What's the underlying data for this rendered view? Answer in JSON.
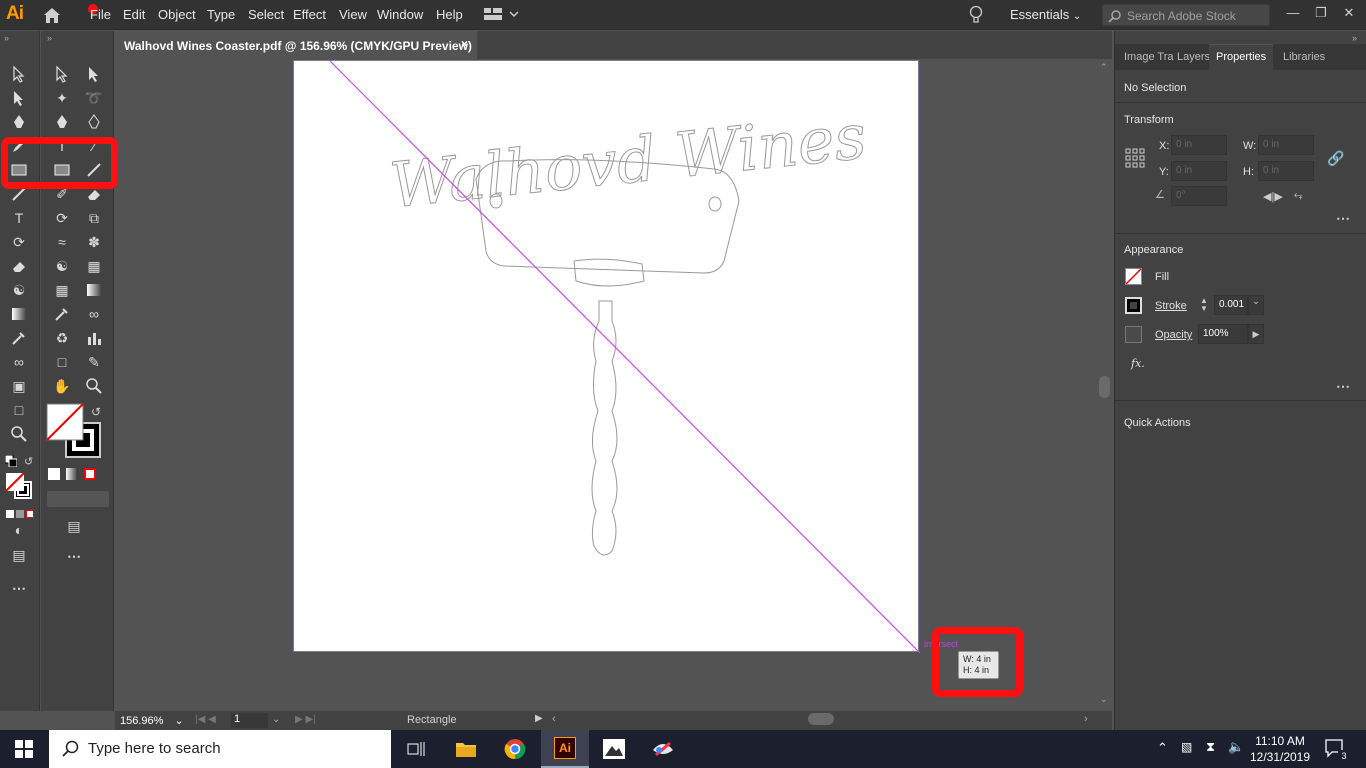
{
  "app": {
    "logo": "Ai",
    "accent": "#ff9a00"
  },
  "menu": [
    "File",
    "Edit",
    "Object",
    "Type",
    "Select",
    "Effect",
    "View",
    "Window",
    "Help"
  ],
  "workspace": {
    "label": "Essentials"
  },
  "search_stock": {
    "placeholder": "Search Adobe Stock"
  },
  "document_tab": {
    "title": "Walhovd Wines Coaster.pdf @ 156.96% (CMYK/GPU Preview)",
    "close": "×"
  },
  "artwork": {
    "text": "Walhovd Wines"
  },
  "canvas": {
    "snap_label": "intersect",
    "tooltip_w": "W: 4 in",
    "tooltip_h": "H: 4 in",
    "highlight_color": "#ff1010"
  },
  "status": {
    "zoom": "156.96%",
    "page": "1",
    "tool": "Rectangle"
  },
  "panel": {
    "tabs": [
      "Image Tra",
      "Layers",
      "Properties",
      "Libraries"
    ],
    "selection": "No Selection",
    "transform": {
      "title": "Transform",
      "x_label": "X:",
      "x_value": "0 in",
      "y_label": "Y:",
      "y_value": "0 in",
      "w_label": "W:",
      "w_value": "0 in",
      "h_label": "H:",
      "h_value": "0 in",
      "angle_value": "0°"
    },
    "appearance": {
      "title": "Appearance",
      "fill": "Fill",
      "stroke": "Stroke",
      "stroke_value": "0.001",
      "opacity": "Opacity",
      "opacity_value": "100%",
      "fx": "fx."
    },
    "quick_actions": "Quick Actions"
  },
  "taskbar": {
    "search": "Type here to search",
    "time": "11:10 AM",
    "date": "12/31/2019",
    "notifications": "3"
  }
}
